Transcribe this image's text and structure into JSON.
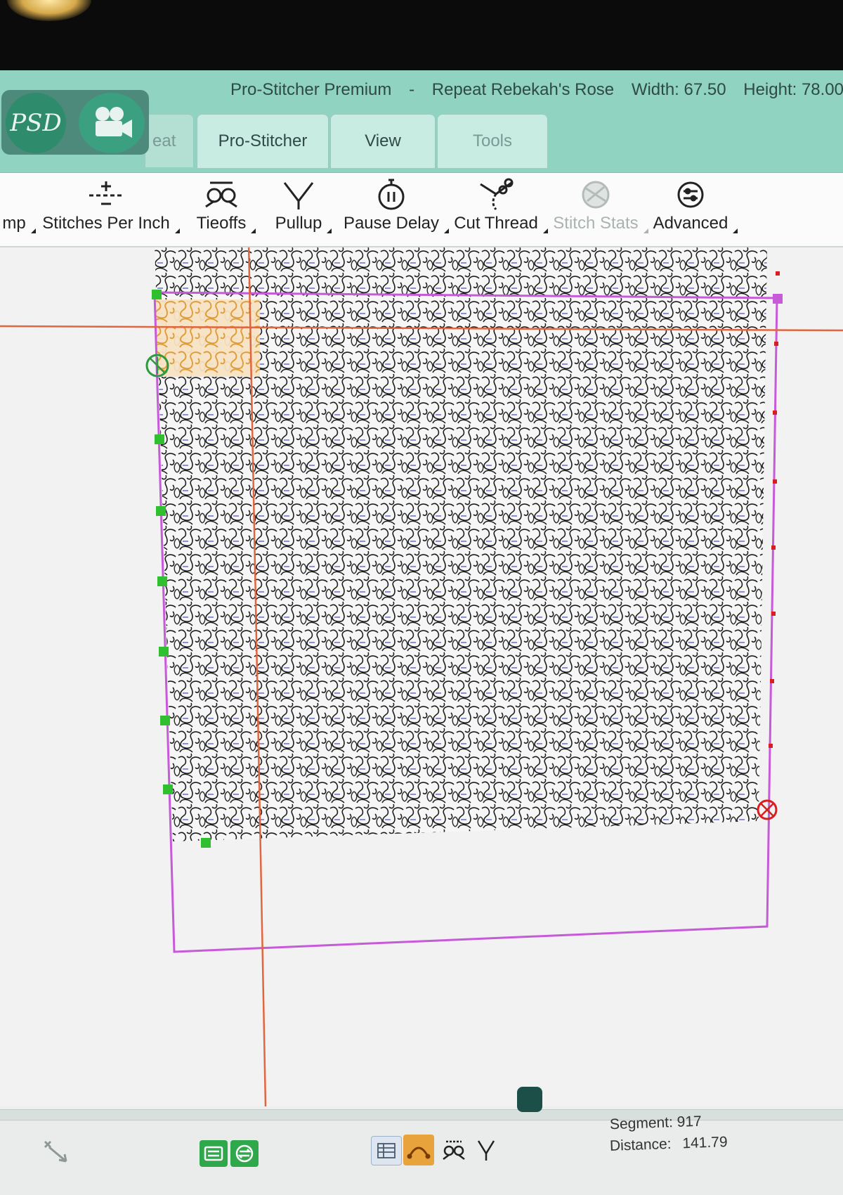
{
  "window": {
    "app_name": "Pro-Stitcher Premium",
    "separator": "-",
    "design_name": "Repeat Rebekah's Rose",
    "width_label": "Width: 67.50",
    "height_label": "Height: 78.00"
  },
  "logo": {
    "text": "PSD",
    "camera_icon": "video-camera-icon"
  },
  "tabs": [
    {
      "label": "eat",
      "state": "partial"
    },
    {
      "label": "Pro-Stitcher",
      "state": "normal"
    },
    {
      "label": "View",
      "state": "normal"
    },
    {
      "label": "Tools",
      "state": "disabled"
    }
  ],
  "ribbon": {
    "partial_label": "mp",
    "buttons": [
      {
        "label": "Stitches Per Inch",
        "icon": "stitches-per-inch-icon"
      },
      {
        "label": "Tieoffs",
        "icon": "tieoffs-icon"
      },
      {
        "label": "Pullup",
        "icon": "pullup-icon"
      },
      {
        "label": "Pause Delay",
        "icon": "pause-delay-icon"
      },
      {
        "label": "Cut Thread",
        "icon": "cut-thread-icon"
      },
      {
        "label": "Stitch Stats",
        "icon": "stitch-stats-icon",
        "disabled": true
      },
      {
        "label": "Advanced",
        "icon": "advanced-icon"
      }
    ]
  },
  "status": {
    "segment_label": "Segment:",
    "segment_value": "917",
    "distance_label": "Distance:",
    "distance_value": "141.79"
  },
  "colors": {
    "title_bar": "#8fd3c0",
    "boundary": "#c65ad8",
    "crosshair": "#e0663f",
    "highlight_segment": "#e8a33c",
    "anchor_marker": "#2fbf2f",
    "stitch_line": "#222222"
  }
}
